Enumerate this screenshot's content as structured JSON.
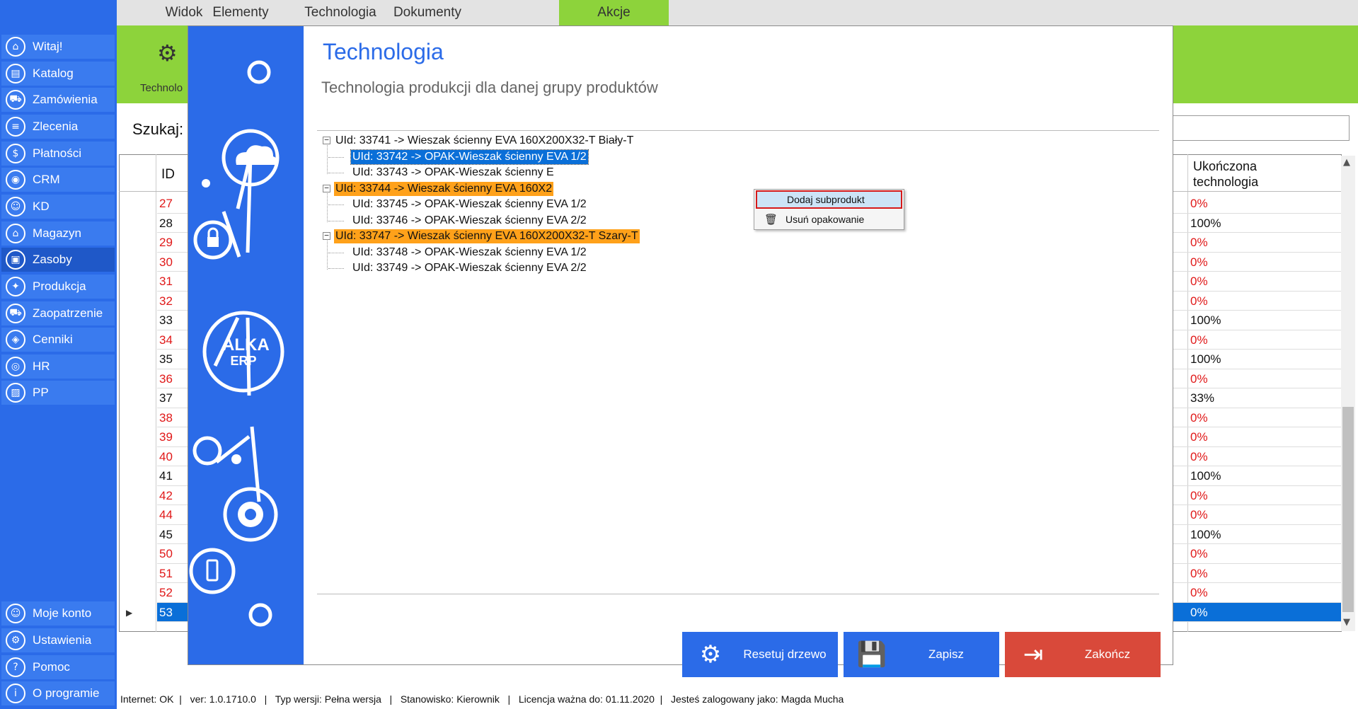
{
  "app": {
    "top_tabs": [
      "Widok",
      "Elementy",
      "Technologia",
      "Dokumenty",
      "Akcje"
    ],
    "active_tab": "Akcje",
    "ribbon_label": "Technolo",
    "search_label": "Szukaj:",
    "accent_color": "#2b6be8",
    "ribbon_color": "#8dd33b"
  },
  "sidebar": {
    "items": [
      {
        "label": "Witaj!",
        "icon": "home-icon"
      },
      {
        "label": "Katalog",
        "icon": "book-icon"
      },
      {
        "label": "Zamówienia",
        "icon": "cart-icon"
      },
      {
        "label": "Zlecenia",
        "icon": "list-icon"
      },
      {
        "label": "Płatności",
        "icon": "dollar-icon"
      },
      {
        "label": "CRM",
        "icon": "crm-icon"
      },
      {
        "label": "KD",
        "icon": "user-icon"
      },
      {
        "label": "Magazyn",
        "icon": "warehouse-icon"
      },
      {
        "label": "Zasoby",
        "icon": "resources-icon"
      },
      {
        "label": "Produkcja",
        "icon": "production-icon"
      },
      {
        "label": "Zaopatrzenie",
        "icon": "truck-icon"
      },
      {
        "label": "Cenniki",
        "icon": "tag-icon"
      },
      {
        "label": "HR",
        "icon": "hr-icon"
      },
      {
        "label": "PP",
        "icon": "pp-icon"
      }
    ],
    "bottom_items": [
      {
        "label": "Moje konto",
        "icon": "account-icon"
      },
      {
        "label": "Ustawienia",
        "icon": "settings-icon"
      },
      {
        "label": "Pomoc",
        "icon": "help-icon"
      },
      {
        "label": "O programie",
        "icon": "info-icon"
      }
    ],
    "active_item": "Zasoby"
  },
  "grid": {
    "headers": {
      "id": "ID",
      "tech": "Ukończona technologia"
    },
    "rows": [
      {
        "id": "27",
        "pct": "0%",
        "red": true
      },
      {
        "id": "28",
        "pct": "100%",
        "red": false
      },
      {
        "id": "29",
        "pct": "0%",
        "red": true
      },
      {
        "id": "30",
        "pct": "0%",
        "red": true
      },
      {
        "id": "31",
        "pct": "0%",
        "red": true
      },
      {
        "id": "32",
        "pct": "0%",
        "red": true
      },
      {
        "id": "33",
        "pct": "100%",
        "red": false
      },
      {
        "id": "34",
        "pct": "0%",
        "red": true
      },
      {
        "id": "35",
        "pct": "100%",
        "red": false
      },
      {
        "id": "36",
        "pct": "0%",
        "red": true
      },
      {
        "id": "37",
        "pct": "33%",
        "red": false
      },
      {
        "id": "38",
        "pct": "0%",
        "red": true
      },
      {
        "id": "39",
        "pct": "0%",
        "red": true
      },
      {
        "id": "40",
        "pct": "0%",
        "red": true
      },
      {
        "id": "41",
        "pct": "100%",
        "red": false
      },
      {
        "id": "42",
        "pct": "0%",
        "red": true
      },
      {
        "id": "44",
        "pct": "0%",
        "red": true
      },
      {
        "id": "45",
        "pct": "100%",
        "red": false
      },
      {
        "id": "50",
        "pct": "0%",
        "red": true
      },
      {
        "id": "51",
        "pct": "0%",
        "red": true
      },
      {
        "id": "52",
        "pct": "0%",
        "red": true
      },
      {
        "id": "53",
        "pct": "0%",
        "red": false,
        "selected": true
      }
    ]
  },
  "dialog": {
    "title": "Technologia",
    "subtitle": "Technologia produkcji dla danej grupy produktów",
    "logo_text_1": "ALKA",
    "logo_text_2": "ERP",
    "tree": [
      {
        "label": "UId: 33741 -> Wieszak ścienny EVA 160X200X32-T Biały-T",
        "level": 0,
        "style": "none",
        "expander": "minus"
      },
      {
        "label": "UId: 33742 -> OPAK-Wieszak ścienny EVA   1/2",
        "level": 1,
        "style": "blue"
      },
      {
        "label": "UId: 33743 -> OPAK-Wieszak ścienny E",
        "level": 1,
        "style": "none"
      },
      {
        "label": "UId: 33744 -> Wieszak ścienny EVA 160X2",
        "level": 0,
        "style": "orange",
        "expander": "minus"
      },
      {
        "label": "UId: 33745 -> OPAK-Wieszak ścienny EVA   1/2",
        "level": 1,
        "style": "none"
      },
      {
        "label": "UId: 33746 -> OPAK-Wieszak ścienny EVA   2/2",
        "level": 1,
        "style": "none"
      },
      {
        "label": "UId: 33747 -> Wieszak ścienny EVA 160X200X32-T Szary-T",
        "level": 0,
        "style": "orange",
        "expander": "minus"
      },
      {
        "label": "UId: 33748 -> OPAK-Wieszak ścienny EVA   1/2",
        "level": 1,
        "style": "none"
      },
      {
        "label": "UId: 33749 -> OPAK-Wieszak ścienny EVA   2/2",
        "level": 1,
        "style": "none"
      }
    ],
    "context_menu": {
      "items": [
        "Dodaj subprodukt",
        "Usuń opakowanie"
      ]
    },
    "buttons": {
      "reset": "Resetuj drzewo",
      "save": "Zapisz",
      "end": "Zakończ"
    }
  },
  "status": {
    "text": "Internet: OK  |   ver: 1.0.1710.0   |   Typ wersji: Pełna wersja   |   Stanowisko: Kierownik   |   Licencja ważna do: 01.11.2020  |   Jesteś zalogowany jako: Magda Mucha"
  }
}
